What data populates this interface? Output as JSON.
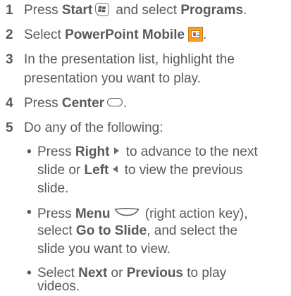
{
  "steps": [
    {
      "number": "1",
      "t1": "Press ",
      "b1": "Start",
      "t2": " and select ",
      "b2": "Programs",
      "t3": "."
    },
    {
      "number": "2",
      "t1": "Select ",
      "b1": "PowerPoint Mobile",
      "t2": "."
    },
    {
      "number": "3",
      "l1": "In the presentation list, highlight the",
      "l2": "presentation you want to play."
    },
    {
      "number": "4",
      "t1": "Press ",
      "b1": "Center",
      "t2": "."
    },
    {
      "number": "5",
      "t1": "Do any of the following:"
    }
  ],
  "sub_items": [
    {
      "bullet": "•",
      "a1": "Press ",
      "ab1": "Right",
      "a2": " to advance to the next",
      "b1": "slide or ",
      "bb1": "Left",
      "b2": " to view the previous",
      "c1": "slide."
    },
    {
      "bullet": "•",
      "a1": "Press ",
      "ab1": "Menu",
      "a2": " (right action key),",
      "b1": "select ",
      "bb1": "Go to Slide",
      "b2": ", and select the",
      "c1": "slide you want to view."
    },
    {
      "bullet": "•",
      "a1": "Select ",
      "ab1": "Next",
      "a2": " or ",
      "ab2": "Previous",
      "a3": " to play",
      "b1": "videos."
    }
  ],
  "icons": {
    "start": "start-key-icon",
    "powerpoint": "powerpoint-mobile-icon",
    "center": "center-key-icon",
    "right": "right-arrow-icon",
    "left": "left-arrow-icon",
    "menu": "menu-key-icon"
  },
  "colors": {
    "text": "#58595b",
    "icon_orange": "#f2a12a"
  }
}
